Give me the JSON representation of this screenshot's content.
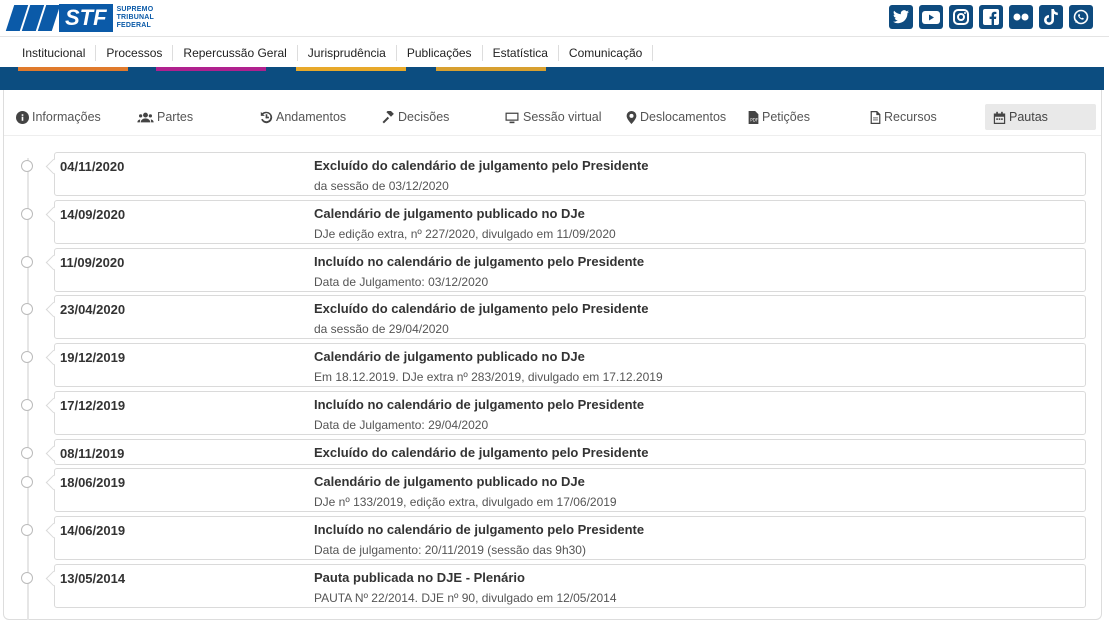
{
  "header": {
    "logo_text": "STF",
    "logo_words": [
      "SUPREMO",
      "TRIBUNAL",
      "FEDERAL"
    ],
    "social": [
      {
        "name": "twitter-icon",
        "glyph": "t"
      },
      {
        "name": "youtube-icon",
        "glyph": "▶"
      },
      {
        "name": "instagram-icon",
        "glyph": "◎"
      },
      {
        "name": "facebook-icon",
        "glyph": "f"
      },
      {
        "name": "flickr-icon",
        "glyph": "••"
      },
      {
        "name": "tiktok-icon",
        "glyph": "♪"
      },
      {
        "name": "whatsapp-icon",
        "glyph": "✆"
      }
    ]
  },
  "nav": {
    "items": [
      "Institucional",
      "Processos",
      "Repercussão Geral",
      "Jurisprudência",
      "Publicações",
      "Estatística",
      "Comunicação"
    ]
  },
  "tabs": [
    {
      "label": "Informações",
      "icon": "info-icon"
    },
    {
      "label": "Partes",
      "icon": "users-icon"
    },
    {
      "label": "Andamentos",
      "icon": "history-icon"
    },
    {
      "label": "Decisões",
      "icon": "gavel-icon"
    },
    {
      "label": "Sessão virtual",
      "icon": "monitor-icon"
    },
    {
      "label": "Deslocamentos",
      "icon": "map-marker-icon"
    },
    {
      "label": "Petições",
      "icon": "pdf-file-icon"
    },
    {
      "label": "Recursos",
      "icon": "document-icon"
    },
    {
      "label": "Pautas",
      "icon": "calendar-icon",
      "active": true
    }
  ],
  "entries": [
    {
      "date": "04/11/2020",
      "title": "Excluído do calendário de julgamento pelo Presidente",
      "desc": "da sessão de 03/12/2020"
    },
    {
      "date": "14/09/2020",
      "title": "Calendário de julgamento publicado no DJe",
      "desc": "DJe edição extra, nº 227/2020, divulgado em 11/09/2020"
    },
    {
      "date": "11/09/2020",
      "title": "Incluído no calendário de julgamento pelo Presidente",
      "desc": "Data de Julgamento: 03/12/2020"
    },
    {
      "date": "23/04/2020",
      "title": "Excluído do calendário de julgamento pelo Presidente",
      "desc": "da sessão de 29/04/2020"
    },
    {
      "date": "19/12/2019",
      "title": "Calendário de julgamento publicado no DJe",
      "desc": "Em 18.12.2019. DJe extra nº 283/2019, divulgado em 17.12.2019"
    },
    {
      "date": "17/12/2019",
      "title": "Incluído no calendário de julgamento pelo Presidente",
      "desc": "Data de Julgamento: 29/04/2020"
    },
    {
      "date": "08/11/2019",
      "title": "Excluído do calendário de julgamento pelo Presidente",
      "desc": ""
    },
    {
      "date": "18/06/2019",
      "title": "Calendário de julgamento publicado no DJe",
      "desc": "DJe nº 133/2019, edição extra, divulgado em 17/06/2019"
    },
    {
      "date": "14/06/2019",
      "title": "Incluído no calendário de julgamento pelo Presidente",
      "desc": "Data de julgamento: 20/11/2019 (sessão das 9h30)"
    },
    {
      "date": "13/05/2014",
      "title": "Pauta publicada no DJE - Plenário",
      "desc": "PAUTA Nº 22/2014. DJE nº 90, divulgado em 12/05/2014"
    }
  ],
  "colors": {
    "brand_blue": "#0b5aa8",
    "band_blue": "#0c4d80",
    "accent_orange": "#e07a2c",
    "accent_magenta": "#b0218e",
    "accent_yellow": "#e8a92a",
    "accent_gold": "#d8a030"
  }
}
